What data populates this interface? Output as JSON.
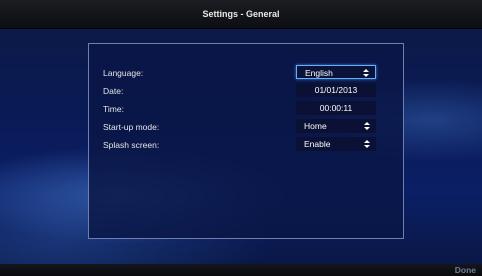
{
  "header": {
    "title": "Settings - General"
  },
  "settings": {
    "language": {
      "label": "Language:",
      "value": "English"
    },
    "date": {
      "label": "Date:",
      "value": "01/01/2013"
    },
    "time": {
      "label": "Time:",
      "value": "00:00:11"
    },
    "startup": {
      "label": "Start-up mode:",
      "value": "Home"
    },
    "splash": {
      "label": "Splash screen:",
      "value": "Enable"
    }
  },
  "footer": {
    "done_label": "Done"
  },
  "icons": {
    "select_arrow": "up-down-chevron-icon"
  },
  "colors": {
    "focus": "#5fb1ff",
    "panel_border": "#6b7fb3"
  }
}
